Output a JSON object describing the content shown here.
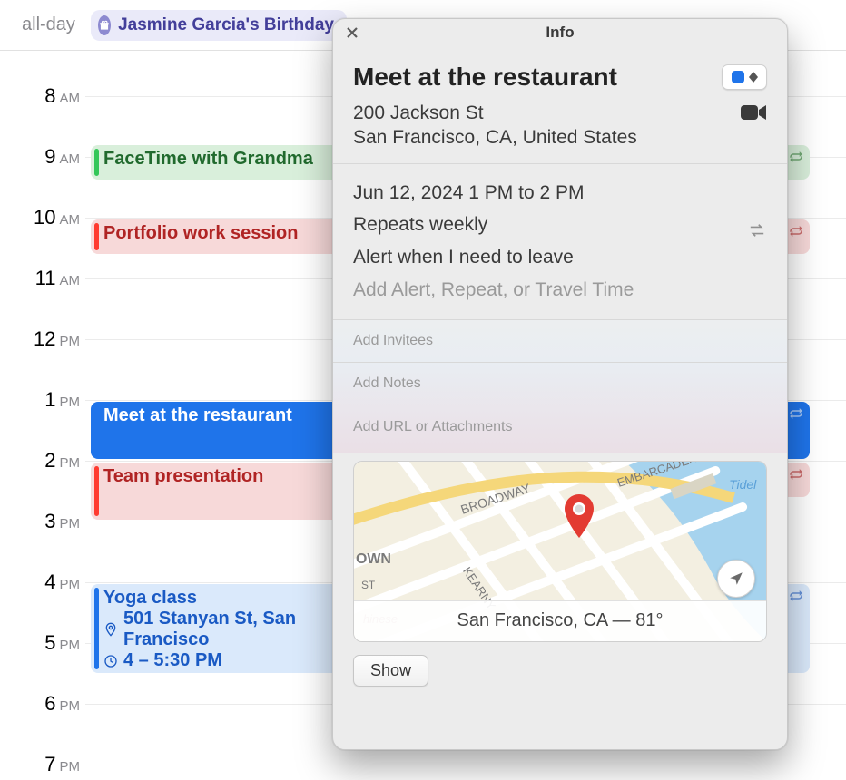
{
  "allday": {
    "label": "all-day",
    "chip_text": "Jasmine Garcia's Birthday"
  },
  "hours": [
    {
      "num": "8",
      "suffix": "AM"
    },
    {
      "num": "9",
      "suffix": "AM"
    },
    {
      "num": "10",
      "suffix": "AM"
    },
    {
      "num": "11",
      "suffix": "AM"
    },
    {
      "num": "12",
      "suffix": "PM"
    },
    {
      "num": "1",
      "suffix": "PM"
    },
    {
      "num": "2",
      "suffix": "PM"
    },
    {
      "num": "3",
      "suffix": "PM"
    },
    {
      "num": "4",
      "suffix": "PM"
    },
    {
      "num": "5",
      "suffix": "PM"
    },
    {
      "num": "6",
      "suffix": "PM"
    },
    {
      "num": "7",
      "suffix": "PM"
    }
  ],
  "events": {
    "facetime": {
      "title": "FaceTime with Grandma"
    },
    "portfolio": {
      "title": "Portfolio work session"
    },
    "meet": {
      "title": "Meet at the restaurant"
    },
    "team": {
      "title": "Team presentation"
    },
    "yoga": {
      "title": "Yoga class",
      "location": "501 Stanyan St, San Francisco",
      "time": "4 – 5:30 PM"
    }
  },
  "popover": {
    "titlebar": "Info",
    "title": "Meet at the restaurant",
    "calendar_color": "#1f74ea",
    "address_line1": "200 Jackson St",
    "address_line2": "San Francisco, CA, United States",
    "datetime": "Jun 12, 2024  1 PM to 2 PM",
    "repeat": "Repeats weekly",
    "alert": "Alert when I need to leave",
    "add_alert_placeholder": "Add Alert, Repeat, or Travel Time",
    "add_invitees_placeholder": "Add Invitees",
    "add_notes_placeholder": "Add Notes",
    "add_url_placeholder": "Add URL or Attachments",
    "map_footer": "San Francisco, CA — 81°",
    "map_streets": {
      "broadway": "BROADWAY",
      "embarcadero": "EMBARCADERO",
      "kearny": "KEARNY",
      "own": "OWN",
      "st": "ST",
      "tidel": "Tidel",
      "chinese": "hinese"
    },
    "show_button": "Show"
  }
}
